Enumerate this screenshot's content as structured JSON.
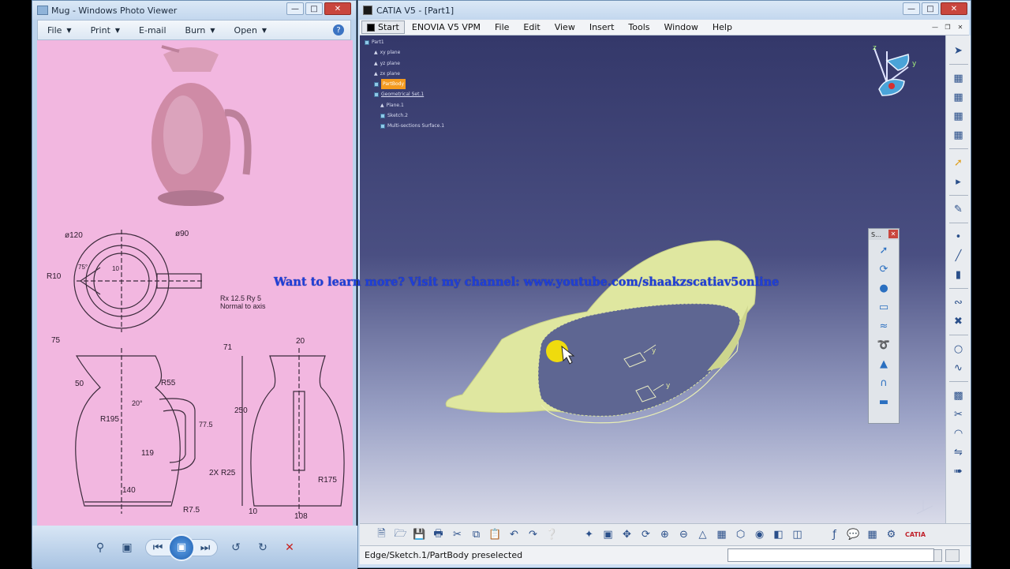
{
  "photo_viewer": {
    "title": "Mug - Windows Photo Viewer",
    "menu": [
      {
        "label": "File",
        "caret": true
      },
      {
        "label": "Print",
        "caret": true
      },
      {
        "label": "E-mail",
        "caret": false
      },
      {
        "label": "Burn",
        "caret": true
      },
      {
        "label": "Open",
        "caret": true
      }
    ],
    "drawing": {
      "dim_phi120": "ø120",
      "dim_phi90": "ø90",
      "dim_r10": "R10",
      "dim_75deg": "75°",
      "dim_10": "10",
      "dim_75": "75",
      "roughness_1": "Rx 12.5 Ry 5",
      "roughness_2": "Normal to axis",
      "dim_71": "71",
      "dim_20": "20",
      "dim_50": "50",
      "dim_r55": "R55",
      "dim_20deg": "20°",
      "dim_r195": "R195",
      "dim_775": "77.5",
      "dim_119": "119",
      "dim_2xr25": "2X R25",
      "dim_140": "140",
      "dim_r75": "R7.5",
      "dim_250": "250",
      "dim_r175": "R175",
      "dim_10b": "10",
      "dim_108": "108"
    }
  },
  "catia": {
    "title": "CATIA V5 - [Part1]",
    "menu": [
      "ENOVIA V5 VPM",
      "File",
      "Edit",
      "View",
      "Insert",
      "Tools",
      "Window",
      "Help"
    ],
    "start_label": "Start",
    "tree": {
      "root": "Part1",
      "items": [
        "xy plane",
        "yz plane",
        "zx plane"
      ],
      "partbody": "PartBody",
      "geoset": "Geometrical Set.1",
      "children": [
        "Plane.1",
        "Sketch.2",
        "Multi-sections Surface.1"
      ]
    },
    "floating_toolbar_title": "S...",
    "status_text": "Edge/Sketch.1/PartBody preselected",
    "brand": "CATIA",
    "compass_labels": {
      "z": "z",
      "y": "y"
    }
  },
  "watermark": "Want to learn more? Visit my channel: www.youtube.com/shaakzscatiav5online",
  "colors": {
    "surface": "#dfe7a0",
    "viewport_top": "#34386a",
    "viewport_bottom": "#d9dbe9",
    "drawing_bg": "#f2b7e0",
    "selection": "#f49a1f",
    "watermark": "#1f3fd8"
  }
}
